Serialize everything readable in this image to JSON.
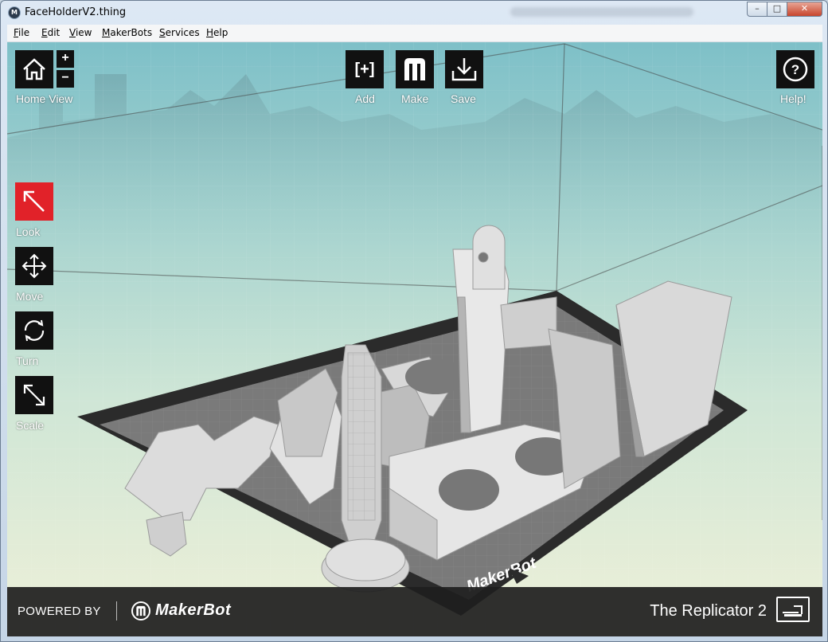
{
  "window": {
    "title": "FaceHolderV2.thing"
  },
  "menubar": {
    "items": [
      {
        "label": "File",
        "key": "F"
      },
      {
        "label": "Edit",
        "key": "E"
      },
      {
        "label": "View",
        "key": "V"
      },
      {
        "label": "MakerBots",
        "key": "M"
      },
      {
        "label": "Services",
        "key": "S"
      },
      {
        "label": "Help",
        "key": "H"
      }
    ]
  },
  "toolbar": {
    "home_view": "Home View",
    "add": "Add",
    "make": "Make",
    "save": "Save",
    "help": "Help!",
    "add_glyph": "[+]",
    "zoom_in": "+",
    "zoom_out": "−"
  },
  "tools": {
    "look": "Look",
    "move": "Move",
    "turn": "Turn",
    "scale": "Scale"
  },
  "plate_brand": "MakerBot",
  "footer": {
    "powered_by": "POWERED BY",
    "brand": "MakerBot",
    "printer": "The Replicator 2"
  },
  "icons": {
    "home": "home-icon",
    "add": "add-icon",
    "make": "makerbot-m-icon",
    "save": "download-icon",
    "help": "question-icon",
    "look": "diagonal-arrow-icon",
    "move": "move-arrows-icon",
    "turn": "rotate-icon",
    "scale": "scale-arrows-icon",
    "printer": "printer-icon"
  },
  "colors": {
    "active_tool": "#e12229",
    "button_bg": "#111111",
    "footer_bg": "#1e1e1e"
  }
}
